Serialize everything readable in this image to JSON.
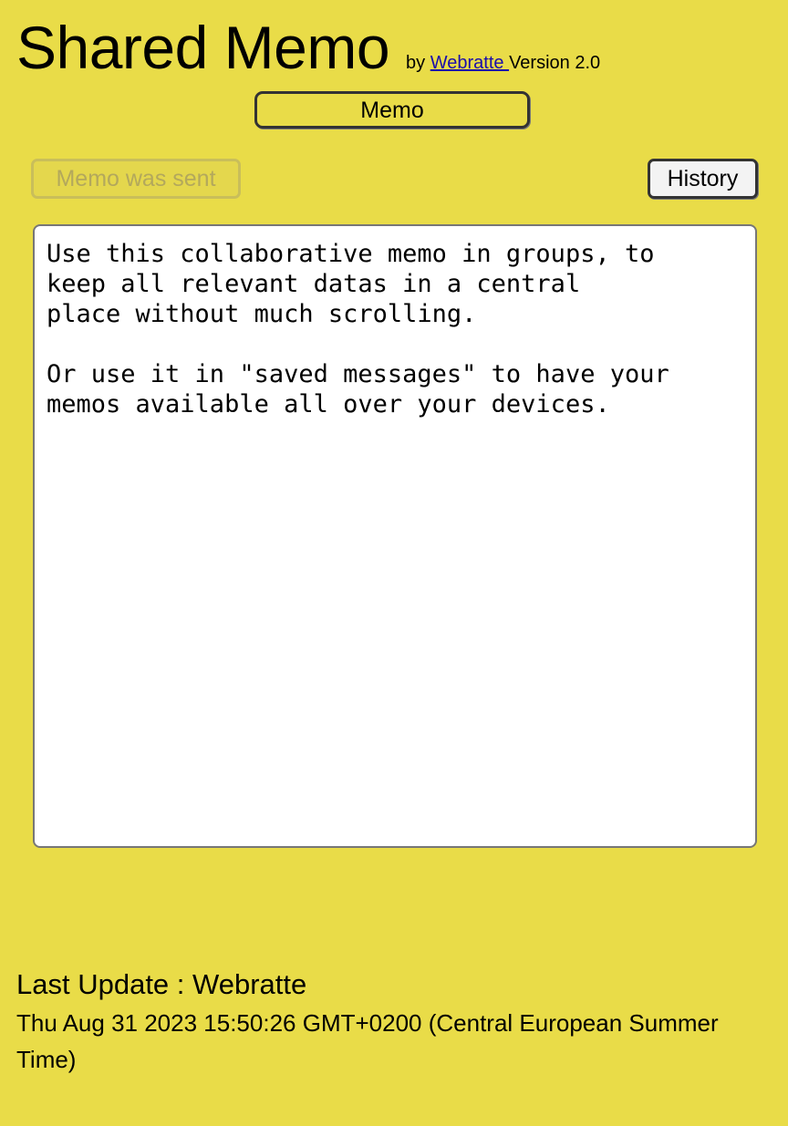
{
  "header": {
    "title": "Shared Memo",
    "by_prefix": "by",
    "author_link": "Webratte ",
    "version": "Version 2.0"
  },
  "tab": {
    "label": "Memo"
  },
  "toolbar": {
    "status_label": "Memo was sent",
    "history_label": "History"
  },
  "memo": {
    "text": "Use this collaborative memo in groups, to\nkeep all relevant datas in a central\nplace without much scrolling.\n\nOr use it in \"saved messages\" to have your\nmemos available all over your devices."
  },
  "footer": {
    "last_update": "Last Update : Webratte",
    "timestamp": "Thu Aug 31 2023 15:50:26 GMT+0200 (Central European Summer Time)"
  },
  "colors": {
    "background": "#e9dc48",
    "link": "#1a0dab"
  }
}
